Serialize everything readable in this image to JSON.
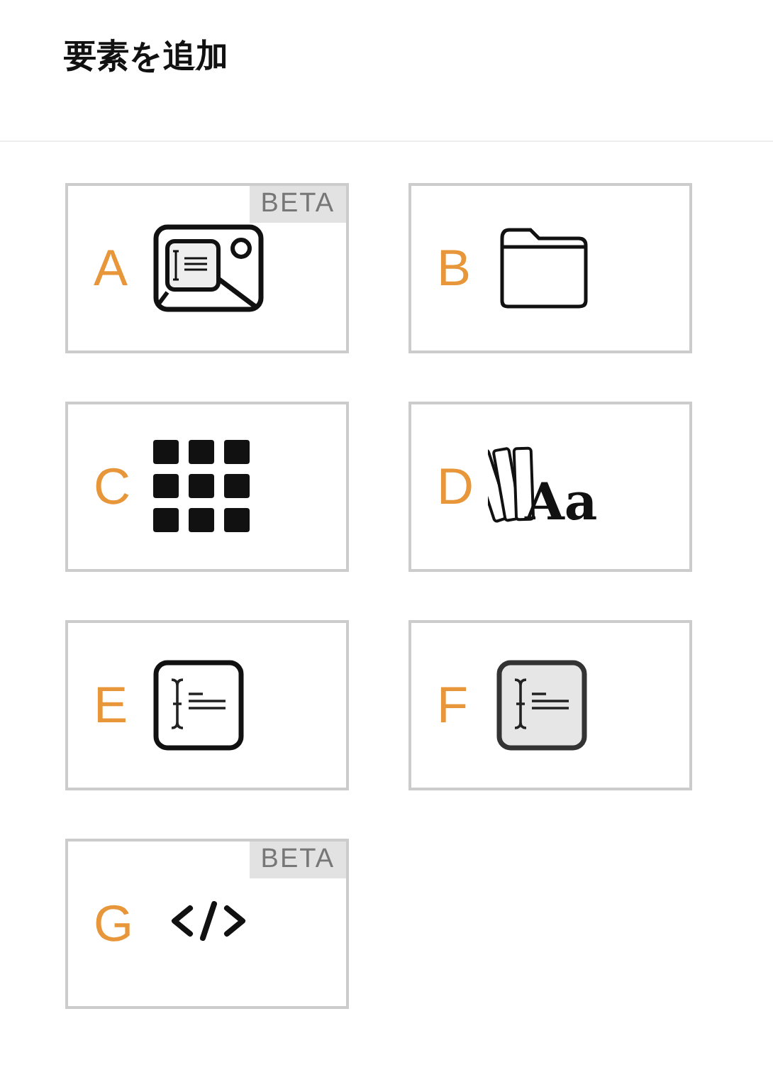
{
  "header": {
    "title": "要素を追加"
  },
  "cards": [
    {
      "letter": "A",
      "kind": "image-text",
      "badge": "BETA"
    },
    {
      "letter": "B",
      "kind": "folder"
    },
    {
      "letter": "C",
      "kind": "grid"
    },
    {
      "letter": "D",
      "kind": "typography",
      "sample": "Aa"
    },
    {
      "letter": "E",
      "kind": "text-box"
    },
    {
      "letter": "F",
      "kind": "text-box-filled"
    },
    {
      "letter": "G",
      "kind": "code",
      "badge": "BETA"
    }
  ]
}
